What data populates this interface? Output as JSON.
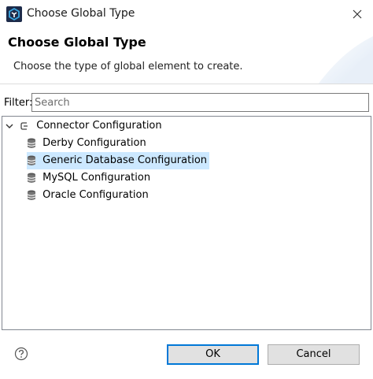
{
  "window": {
    "title": "Choose Global Type"
  },
  "header": {
    "title": "Choose Global Type",
    "description": "Choose the type of global element to create."
  },
  "filter": {
    "label": "Filter:",
    "placeholder": "Search",
    "value": ""
  },
  "tree": {
    "root": {
      "label": "Connector Configuration",
      "expanded": true
    },
    "items": [
      {
        "label": "Derby Configuration",
        "selected": false
      },
      {
        "label": "Generic Database Configuration",
        "selected": true
      },
      {
        "label": "MySQL Configuration",
        "selected": false
      },
      {
        "label": "Oracle Configuration",
        "selected": false
      }
    ]
  },
  "buttons": {
    "ok": "OK",
    "cancel": "Cancel"
  },
  "icons": {
    "app": "mule-app-icon",
    "close": "close-icon",
    "help": "help-icon",
    "connector": "connector-icon",
    "database": "database-icon"
  },
  "colors": {
    "selection": "#cce8ff",
    "default_button_border": "#0078d7"
  }
}
